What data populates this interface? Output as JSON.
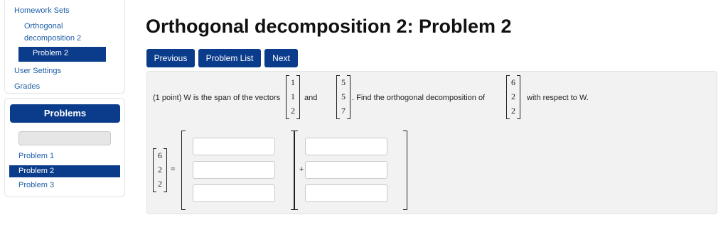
{
  "sidebar": {
    "homework_sets": "Homework Sets",
    "set_line1": "Orthogonal",
    "set_line2": "decomposition 2",
    "current_problem": "Problem 2",
    "user_settings": "User Settings",
    "grades": "Grades"
  },
  "problems_panel": {
    "header": "Problems",
    "search_value": "",
    "items": [
      "Problem 1",
      "Problem 2",
      "Problem 3"
    ],
    "active_index": 1
  },
  "main": {
    "title": "Orthogonal decomposition 2: Problem 2",
    "buttons": {
      "previous": "Previous",
      "problem_list": "Problem List",
      "next": "Next"
    }
  },
  "problem": {
    "text_prefix": "(1 point) W is the span of the vectors",
    "and": "and",
    "text_middle": ". Find the orthogonal decomposition of",
    "text_suffix": "with respect to W.",
    "vector_a": [
      "1",
      "1",
      "2"
    ],
    "vector_b": [
      "5",
      "5",
      "7"
    ],
    "vector_y": [
      "6",
      "2",
      "2"
    ],
    "equals": "=",
    "plus": "+"
  },
  "colors": {
    "accent": "#0b3c8c",
    "link": "#1f5fa8",
    "panel_bg": "#f2f2f2"
  }
}
